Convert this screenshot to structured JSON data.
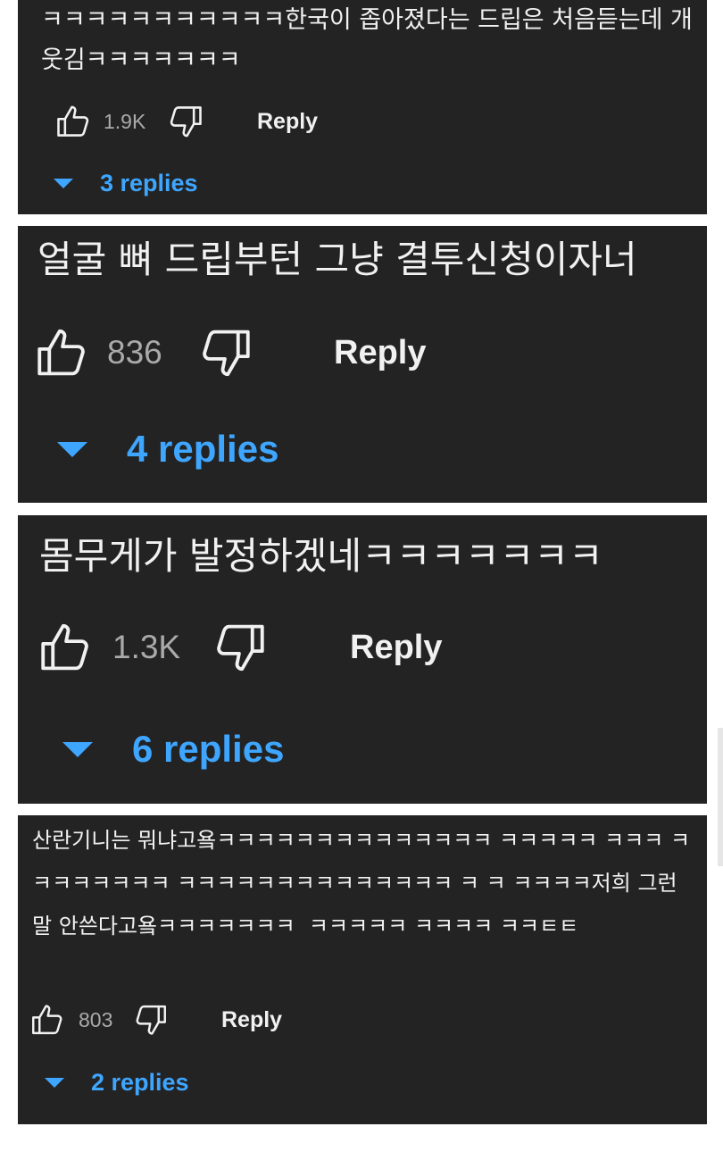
{
  "comments": [
    {
      "text": "ㅋㅋㅋㅋㅋㅋㅋㅋㅋㅋㅋ한국이 좁아졌다는 드립은 처음듣는데 개웃김ㅋㅋㅋㅋㅋㅋㅋ",
      "likes": "1.9K",
      "reply_label": "Reply",
      "replies_label": "3 replies"
    },
    {
      "text": "얼굴 뼈 드립부턴 그냥 결투신청이자너",
      "likes": "836",
      "reply_label": "Reply",
      "replies_label": "4 replies"
    },
    {
      "text": "몸무게가 발정하겠네ㅋㅋㅋㅋㅋㅋㅋ",
      "likes": "1.3K",
      "reply_label": "Reply",
      "replies_label": "6 replies"
    },
    {
      "text": "산란기니는 뭐냐고욬ㅋㅋㅋㅋㅋㅋㅋㅋㅋㅋㅋㅋㅋㅋ ㅋㅋㅋㅋㅋ ㅋㅋㅋ ㅋㅋㅋㅋㅋㅋㅋㅋ ㅋㅋㅋㅋㅋㅋㅋㅋㅋㅋㅋㅋㅋㅋ ㅋ ㅋ ㅋㅋㅋㅋ저희 그런말 안쓴다고욬ㅋㅋㅋㅋㅋㅋㅋ  ㅋㅋㅋㅋㅋ ㅋㅋㅋㅋ ㅋㅋㅌㅌ",
      "likes": "803",
      "reply_label": "Reply",
      "replies_label": "2 replies"
    }
  ],
  "colors": {
    "card_background": "#232323",
    "text": "#f1f1f1",
    "secondary_text": "#aaaaaa",
    "link_blue": "#3ea6ff"
  },
  "icons": [
    "thumbs-up-icon",
    "thumbs-down-icon",
    "caret-down-icon"
  ]
}
